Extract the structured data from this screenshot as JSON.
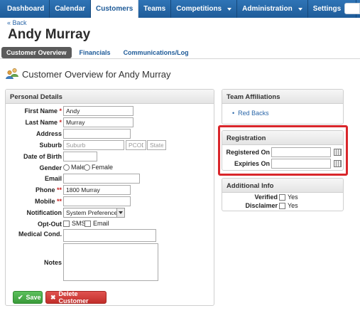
{
  "nav": {
    "items": [
      {
        "label": "Dashboard",
        "has_caret": false,
        "active": false
      },
      {
        "label": "Calendar",
        "has_caret": false,
        "active": false
      },
      {
        "label": "Customers",
        "has_caret": false,
        "active": true
      },
      {
        "label": "Teams",
        "has_caret": false,
        "active": false
      },
      {
        "label": "Competitions",
        "has_caret": true,
        "active": false
      },
      {
        "label": "Administration",
        "has_caret": true,
        "active": false
      },
      {
        "label": "Settings",
        "has_caret": true,
        "active": false
      }
    ]
  },
  "back_link": "« Back",
  "page_title": "Andy Murray",
  "subnav": {
    "tabs": [
      "Customer Overview",
      "Financials",
      "Communications/Log"
    ]
  },
  "overview_title": "Customer Overview for Andy Murray",
  "personal": {
    "heading": "Personal Details",
    "first_name": {
      "label": "First Name",
      "value": "Andy"
    },
    "last_name": {
      "label": "Last Name",
      "value": "Murray"
    },
    "address": {
      "label": "Address",
      "value": ""
    },
    "suburb": {
      "label": "Suburb",
      "placeholder": "Suburb",
      "pcode_placeholder": "PCODE",
      "state_placeholder": "State"
    },
    "dob": {
      "label": "Date of Birth",
      "value": ""
    },
    "gender": {
      "label": "Gender",
      "options": [
        "Male",
        "Female"
      ]
    },
    "email": {
      "label": "Email",
      "value": ""
    },
    "phone": {
      "label": "Phone",
      "value": "1800 Murray"
    },
    "mobile": {
      "label": "Mobile",
      "value": ""
    },
    "notification": {
      "label": "Notification",
      "value": "System Preference"
    },
    "optout": {
      "label": "Opt-Out",
      "options": [
        "SMS",
        "Email"
      ]
    },
    "medical": {
      "label": "Medical Cond.",
      "value": ""
    },
    "notes": {
      "label": "Notes",
      "value": ""
    }
  },
  "buttons": {
    "save": "Save",
    "delete": "Delete Customer"
  },
  "team": {
    "heading": "Team Affiliations",
    "items": [
      "Red Backs"
    ]
  },
  "registration": {
    "heading": "Registration",
    "registered_on": "Registered On",
    "expires_on": "Expiries On"
  },
  "additional": {
    "heading": "Additional Info",
    "verified": {
      "label": "Verified",
      "option": "Yes"
    },
    "disclaimer": {
      "label": "Disclaimer",
      "option": "Yes"
    }
  },
  "colors": {
    "nav_bg": "#2a6aab",
    "link": "#2a66a8",
    "highlight": "#d9262b",
    "save": "#4cae4c",
    "delete": "#d2322d",
    "required": "#c91f1f"
  }
}
